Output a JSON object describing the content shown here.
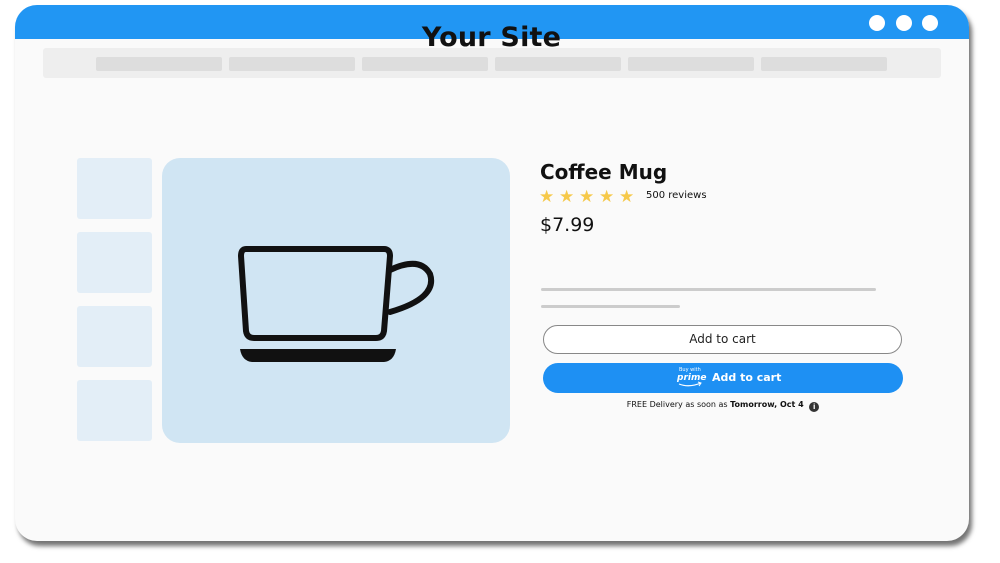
{
  "site": {
    "title": "Your Site"
  },
  "window": {
    "control_icons": [
      "circle-dot",
      "circle-dot",
      "circle-dot"
    ]
  },
  "product": {
    "name": "Coffee Mug",
    "rating": 5,
    "rating_max": 5,
    "reviews_label": "500 reviews",
    "price": "$7.99",
    "image_icon": "coffee-cup-icon"
  },
  "actions": {
    "add_to_cart_label": "Add to cart",
    "prime_badge_small": "Buy with",
    "prime_badge_word": "prime",
    "prime_add_to_cart_label": "Add to cart"
  },
  "delivery": {
    "prefix": "FREE Delivery as soon as",
    "date": "Tomorrow, Oct 4",
    "info_icon": "info-icon"
  },
  "colors": {
    "titlebar": "#2196f3",
    "prime_button": "#1e90f3",
    "stars": "#f6c94a",
    "image_background": "#d0e5f3",
    "thumbnail_background": "#e3eef7"
  }
}
